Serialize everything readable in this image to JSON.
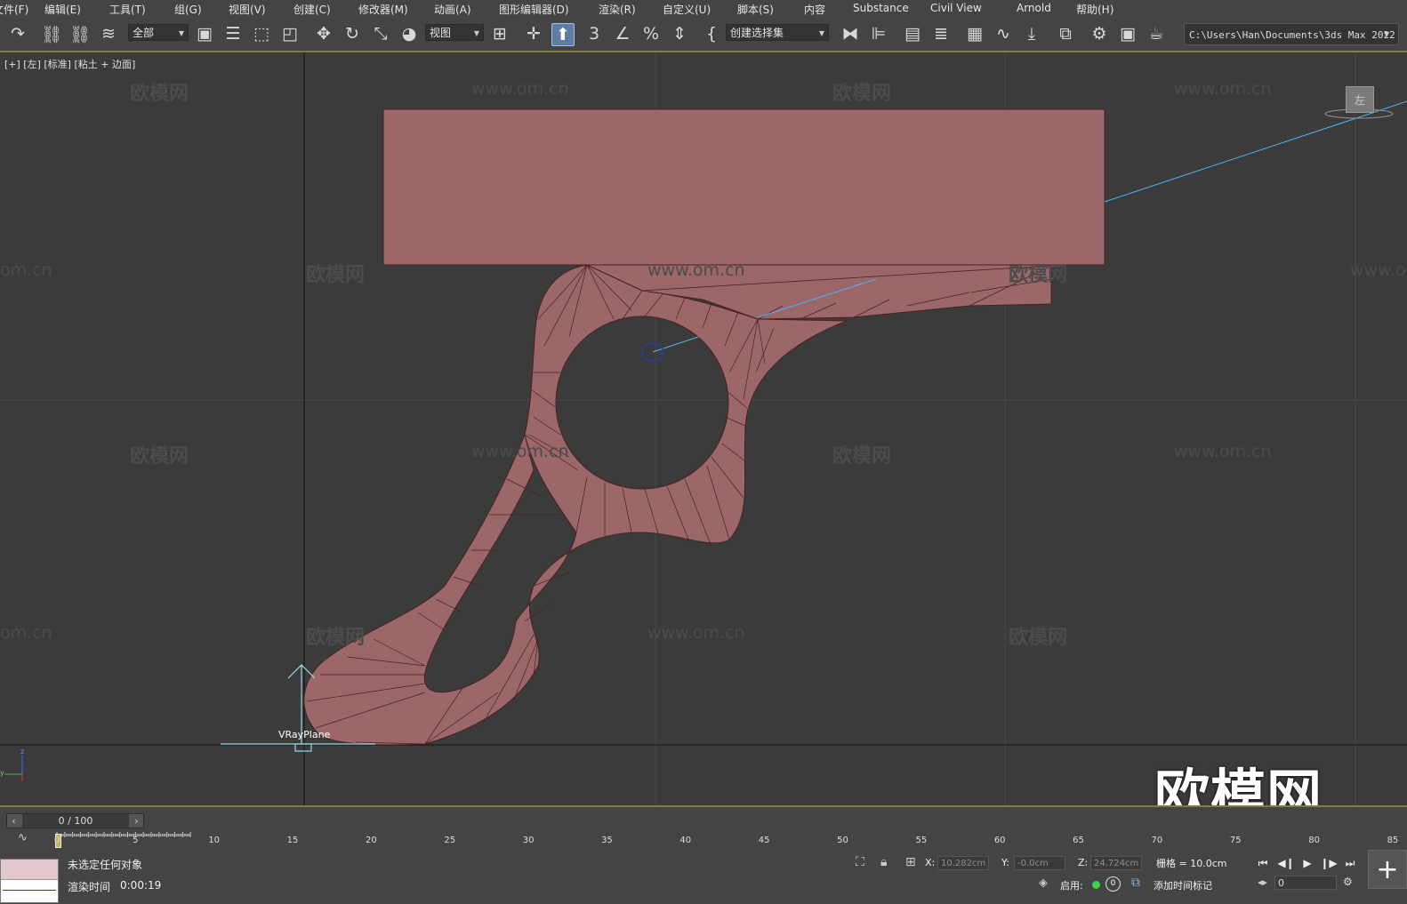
{
  "menu": [
    "文件(F)",
    "编辑(E)",
    "工具(T)",
    "组(G)",
    "视图(V)",
    "创建(C)",
    "修改器(M)",
    "动画(A)",
    "图形编辑器(D)",
    "渲染(R)",
    "自定义(U)",
    "脚本(S)",
    "内容",
    "Substance",
    "Civil View",
    "Arnold",
    "帮助(H)"
  ],
  "toolbar": {
    "filter_value": "全部",
    "ref_coord_value": "视图",
    "snap_label": "3",
    "selection_set_value": "创建选择集",
    "project_path": "C:\\Users\\Han\\Documents\\3ds Max 2022"
  },
  "viewport": {
    "label": "[+] [左] [标准] [粘土 + 边面]",
    "viewcube_face": "左",
    "object_label": "VRayPlane",
    "watermark_cn": "欧模网",
    "watermark_url": "www.om.cn",
    "watermark_url_cut": "om.cn",
    "logo": "欧模网",
    "axis_z": "z",
    "axis_y": "y"
  },
  "timeline": {
    "frame_display": "0 / 100",
    "ticks": [
      "0",
      "5",
      "10",
      "15",
      "20",
      "25",
      "30",
      "35",
      "40",
      "45",
      "50",
      "55",
      "60",
      "65",
      "70",
      "75",
      "80",
      "85"
    ]
  },
  "status": {
    "selection_text": "未选定任何对象",
    "render_time_label": "渲染时间",
    "render_time_value": "0:00:19",
    "x_label": "X:",
    "x_value": "10.282cm",
    "y_label": "Y:",
    "y_value": "-0.0cm",
    "z_label": "Z:",
    "z_value": "24.724cm",
    "grid_text": "栅格 = 10.0cm",
    "enable_label": "启用:",
    "enable_count": "0",
    "add_time_tag": "添加时间标记",
    "current_frame": "0"
  },
  "colors": {
    "mesh_fill": "#9b6769",
    "mesh_edge": "#4a2224",
    "accent_line": "#8a7a3a",
    "active_button": "#5d7da3",
    "viewport_bg": "#3b3b3b"
  }
}
